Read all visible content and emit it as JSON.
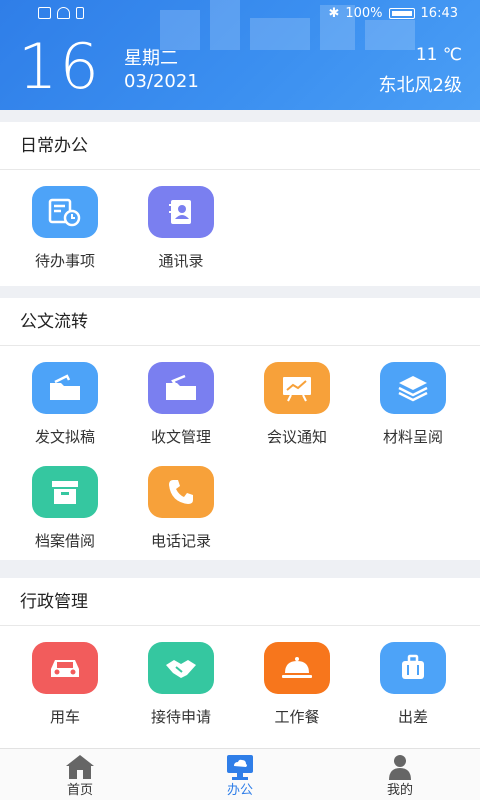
{
  "status": {
    "battery": "100%",
    "time": "16:43"
  },
  "header": {
    "day": "16",
    "weekday": "星期二",
    "month_year": "03/2021",
    "temperature": "11 ℃",
    "wind": "东北风2级"
  },
  "sections": [
    {
      "title": "日常办公",
      "items": [
        {
          "label": "待办事项",
          "icon": "todo-clock-icon",
          "color": "#4da3f8"
        },
        {
          "label": "通讯录",
          "icon": "contacts-book-icon",
          "color": "#7a7ff0"
        }
      ]
    },
    {
      "title": "公文流转",
      "items": [
        {
          "label": "发文拟稿",
          "icon": "outgoing-folder-icon",
          "color": "#4da3f8"
        },
        {
          "label": "收文管理",
          "icon": "incoming-folder-icon",
          "color": "#7a7ff0"
        },
        {
          "label": "会议通知",
          "icon": "presentation-board-icon",
          "color": "#f7a13a"
        },
        {
          "label": "材料呈阅",
          "icon": "layers-stack-icon",
          "color": "#4da3f8"
        },
        {
          "label": "档案借阅",
          "icon": "archive-box-icon",
          "color": "#35c7a0"
        },
        {
          "label": "电话记录",
          "icon": "phone-icon",
          "color": "#f7a13a"
        }
      ]
    },
    {
      "title": "行政管理",
      "items": [
        {
          "label": "用车",
          "icon": "car-icon",
          "color": "#f25c5c"
        },
        {
          "label": "接待申请",
          "icon": "handshake-icon",
          "color": "#35c7a0"
        },
        {
          "label": "工作餐",
          "icon": "meal-cloche-icon",
          "color": "#f7761c"
        },
        {
          "label": "出差",
          "icon": "suitcase-icon",
          "color": "#4da3f8"
        }
      ]
    }
  ],
  "nav": [
    {
      "label": "首页",
      "icon": "home-icon"
    },
    {
      "label": "办公",
      "icon": "office-monitor-icon"
    },
    {
      "label": "我的",
      "icon": "user-profile-icon"
    }
  ]
}
